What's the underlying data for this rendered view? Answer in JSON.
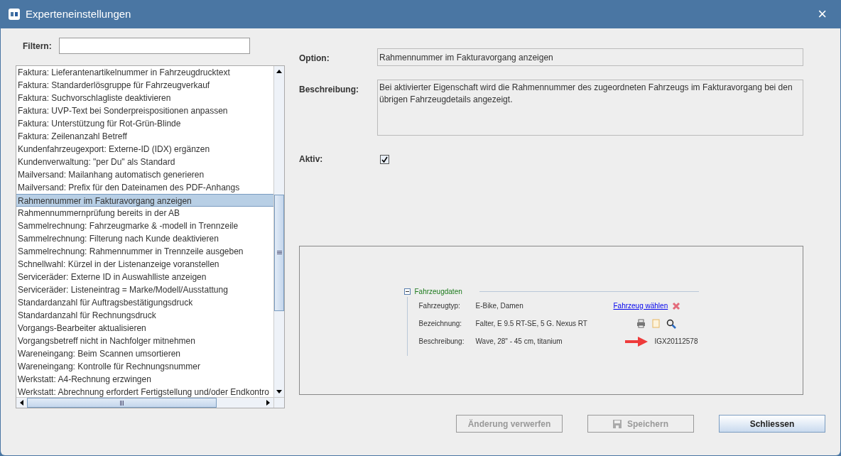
{
  "window": {
    "title": "Experteneinstellungen",
    "close": "×"
  },
  "filter": {
    "label": "Filtern:"
  },
  "list": {
    "items": [
      {
        "label": "Faktura: Lieferantenartikelnummer in Fahrzeugdrucktext",
        "selected": false
      },
      {
        "label": "Faktura: Standarderlösgruppe für Fahrzeugverkauf",
        "selected": false
      },
      {
        "label": "Faktura: Suchvorschlagliste deaktivieren",
        "selected": false
      },
      {
        "label": "Faktura: UVP-Text bei Sonderpreispositionen anpassen",
        "selected": false
      },
      {
        "label": "Faktura: Unterstützung für Rot-Grün-Blinde",
        "selected": false
      },
      {
        "label": "Faktura: Zeilenanzahl Betreff",
        "selected": false
      },
      {
        "label": "Kundenfahrzeugexport: Externe-ID (IDX) ergänzen",
        "selected": false
      },
      {
        "label": "Kundenverwaltung: \"per Du\" als Standard",
        "selected": false
      },
      {
        "label": "Mailversand: Mailanhang automatisch generieren",
        "selected": false
      },
      {
        "label": "Mailversand: Prefix für den Dateinamen des PDF-Anhangs",
        "selected": false
      },
      {
        "label": "Rahmennummer im Fakturavorgang anzeigen",
        "selected": true
      },
      {
        "label": "Rahmennummernprüfung bereits in der AB",
        "selected": false
      },
      {
        "label": "Sammelrechnung: Fahrzeugmarke & -modell in Trennzeile",
        "selected": false
      },
      {
        "label": "Sammelrechnung: Filterung nach Kunde deaktivieren",
        "selected": false
      },
      {
        "label": "Sammelrechnung: Rahmennummer in Trennzeile ausgeben",
        "selected": false
      },
      {
        "label": "Schnellwahl: Kürzel in der Listenanzeige voranstellen",
        "selected": false
      },
      {
        "label": "Serviceräder: Externe ID in Auswahlliste anzeigen",
        "selected": false
      },
      {
        "label": "Serviceräder: Listeneintrag = Marke/Modell/Ausstattung",
        "selected": false
      },
      {
        "label": "Standardanzahl für Auftragsbestätigungsdruck",
        "selected": false
      },
      {
        "label": "Standardanzahl für Rechnungsdruck",
        "selected": false
      },
      {
        "label": "Vorgangs-Bearbeiter aktualisieren",
        "selected": false
      },
      {
        "label": "Vorgangsbetreff nicht in Nachfolger mitnehmen",
        "selected": false
      },
      {
        "label": "Wareneingang: Beim Scannen umsortieren",
        "selected": false
      },
      {
        "label": "Wareneingang: Kontrolle für Rechnungsnummer",
        "selected": false
      },
      {
        "label": "Werkstatt: A4-Rechnung erzwingen",
        "selected": false
      },
      {
        "label": "Werkstatt: Abrechnung erfordert Fertigstellung und/oder Endkontro",
        "selected": false
      }
    ]
  },
  "option": {
    "label": "Option:",
    "value": "Rahmennummer im Fakturavorgang anzeigen"
  },
  "description": {
    "label": "Beschreibung:",
    "value": "Bei aktivierter Eigenschaft wird die Rahmennummer des zugeordneten Fahrzeugs im Fakturavorgang bei den übrigen Fahrzeugdetails angezeigt."
  },
  "active": {
    "label": "Aktiv:",
    "checked": true
  },
  "preview": {
    "group_title": "Fahrzeugdaten",
    "expanded": true,
    "link": "Fahrzeug wählen",
    "rows": [
      {
        "label": "Fahrzeugtyp:",
        "value": "E-Bike, Damen"
      },
      {
        "label": "Bezeichnung:",
        "value": "Falter, E 9.5 RT-SE, 5 G. Nexus RT"
      },
      {
        "label": "Beschreibung:",
        "value": "Wave, 28\" - 45 cm, titanium"
      }
    ],
    "frame_number": "IGX20112578"
  },
  "buttons": [
    {
      "label": "Änderung verwerfen",
      "disabled": true,
      "kind": "plain"
    },
    {
      "label": "Speichern",
      "disabled": true,
      "kind": "save"
    },
    {
      "label": "Schliessen",
      "disabled": false,
      "kind": "primary"
    }
  ]
}
